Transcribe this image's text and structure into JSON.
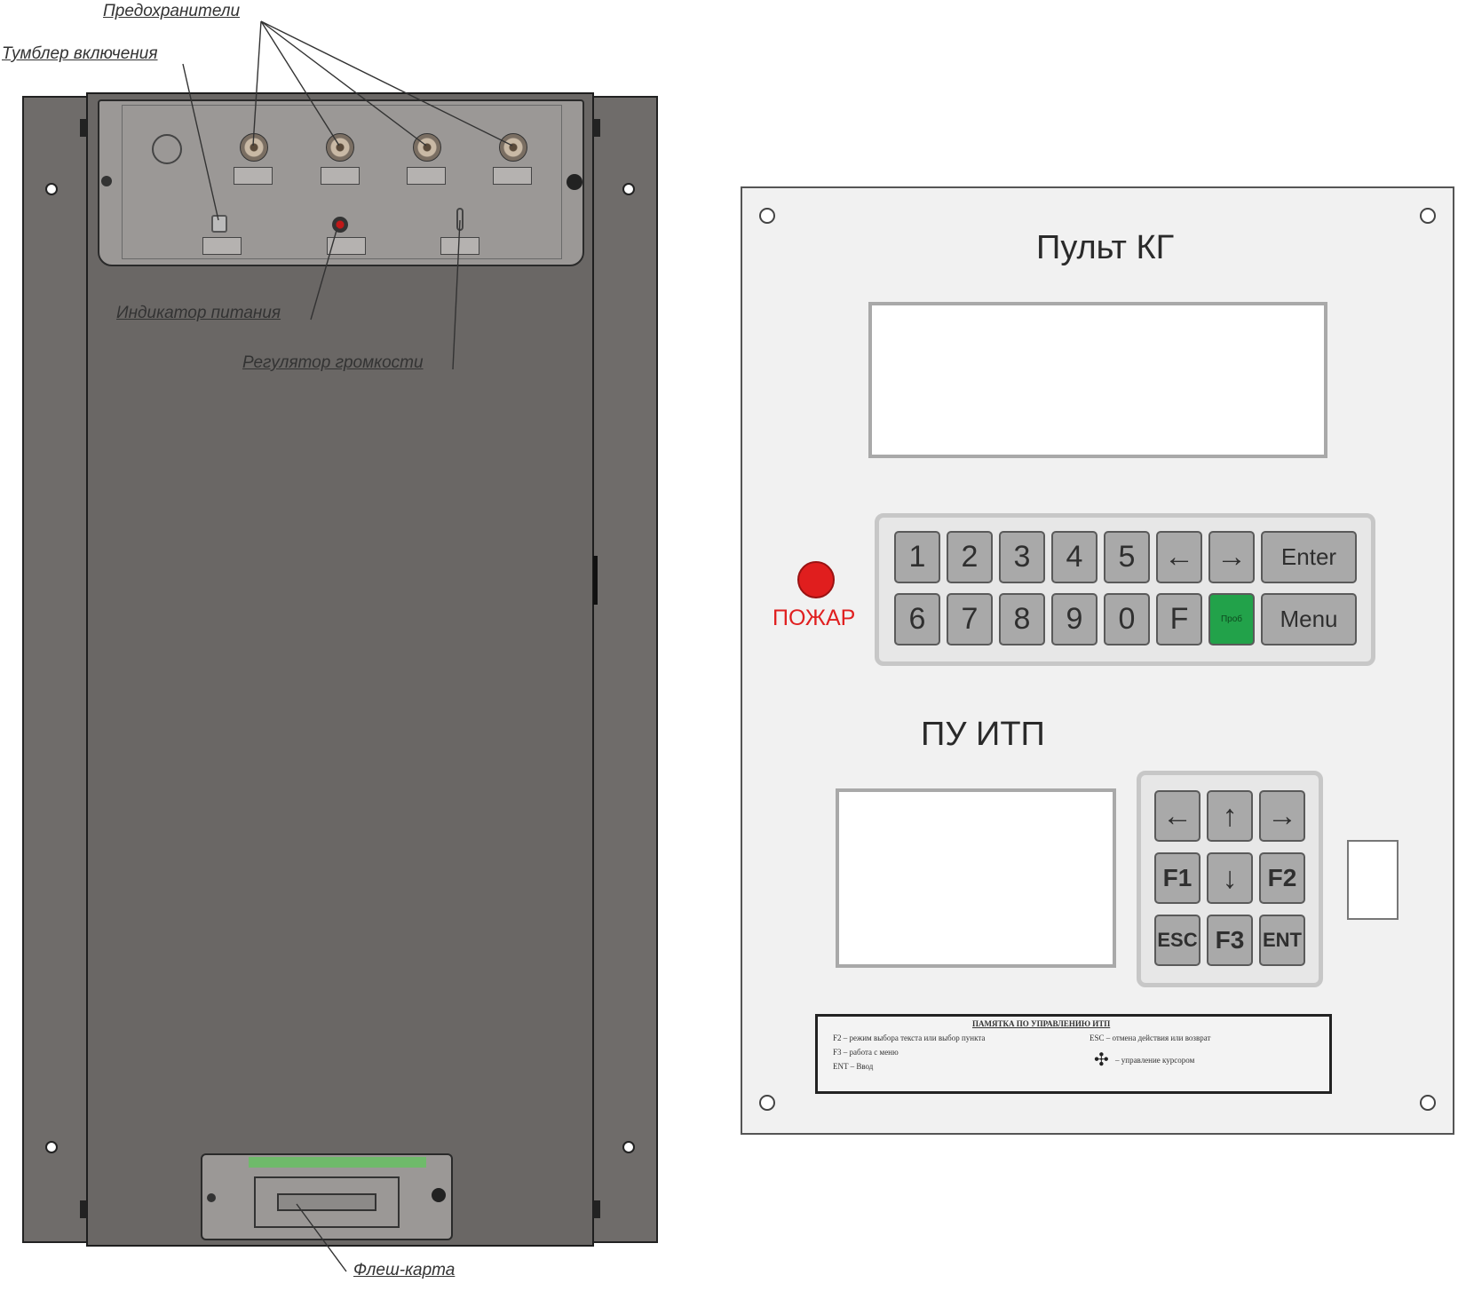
{
  "callouts": {
    "fuses": "Предохранители",
    "power_switch": "Тумблер включения",
    "power_indicator": "Индикатор питания",
    "volume_regulator": "Регулятор громкости",
    "flash_card": "Флеш-карта"
  },
  "kg_panel": {
    "title": "Пульт КГ",
    "fire_label": "ПОЖАР",
    "keys_row1": [
      "1",
      "2",
      "3",
      "4",
      "5",
      "←",
      "→",
      "Enter"
    ],
    "keys_row2": [
      "6",
      "7",
      "8",
      "9",
      "0",
      "F",
      "Проб",
      "Menu"
    ]
  },
  "itp_panel": {
    "title": "ПУ ИТП",
    "keys": [
      "←",
      "↑",
      "→",
      "F1",
      "↓",
      "F2",
      "ESC",
      "F3",
      "ENT"
    ]
  },
  "memo": {
    "title": "ПАМЯТКА ПО УПРАВЛЕНИЮ ИТП",
    "line1": "F2 – режим выбора текста или выбор пункта",
    "line2": "F3 – работа с меню",
    "line3": "ENT – Ввод",
    "line4": "ESC – отмена действия или возврат",
    "line5": "– управление курсором"
  },
  "colors": {
    "cabinet": "#6f6c6a",
    "fire_button": "#e01e1e",
    "test_key": "#22a24a"
  }
}
